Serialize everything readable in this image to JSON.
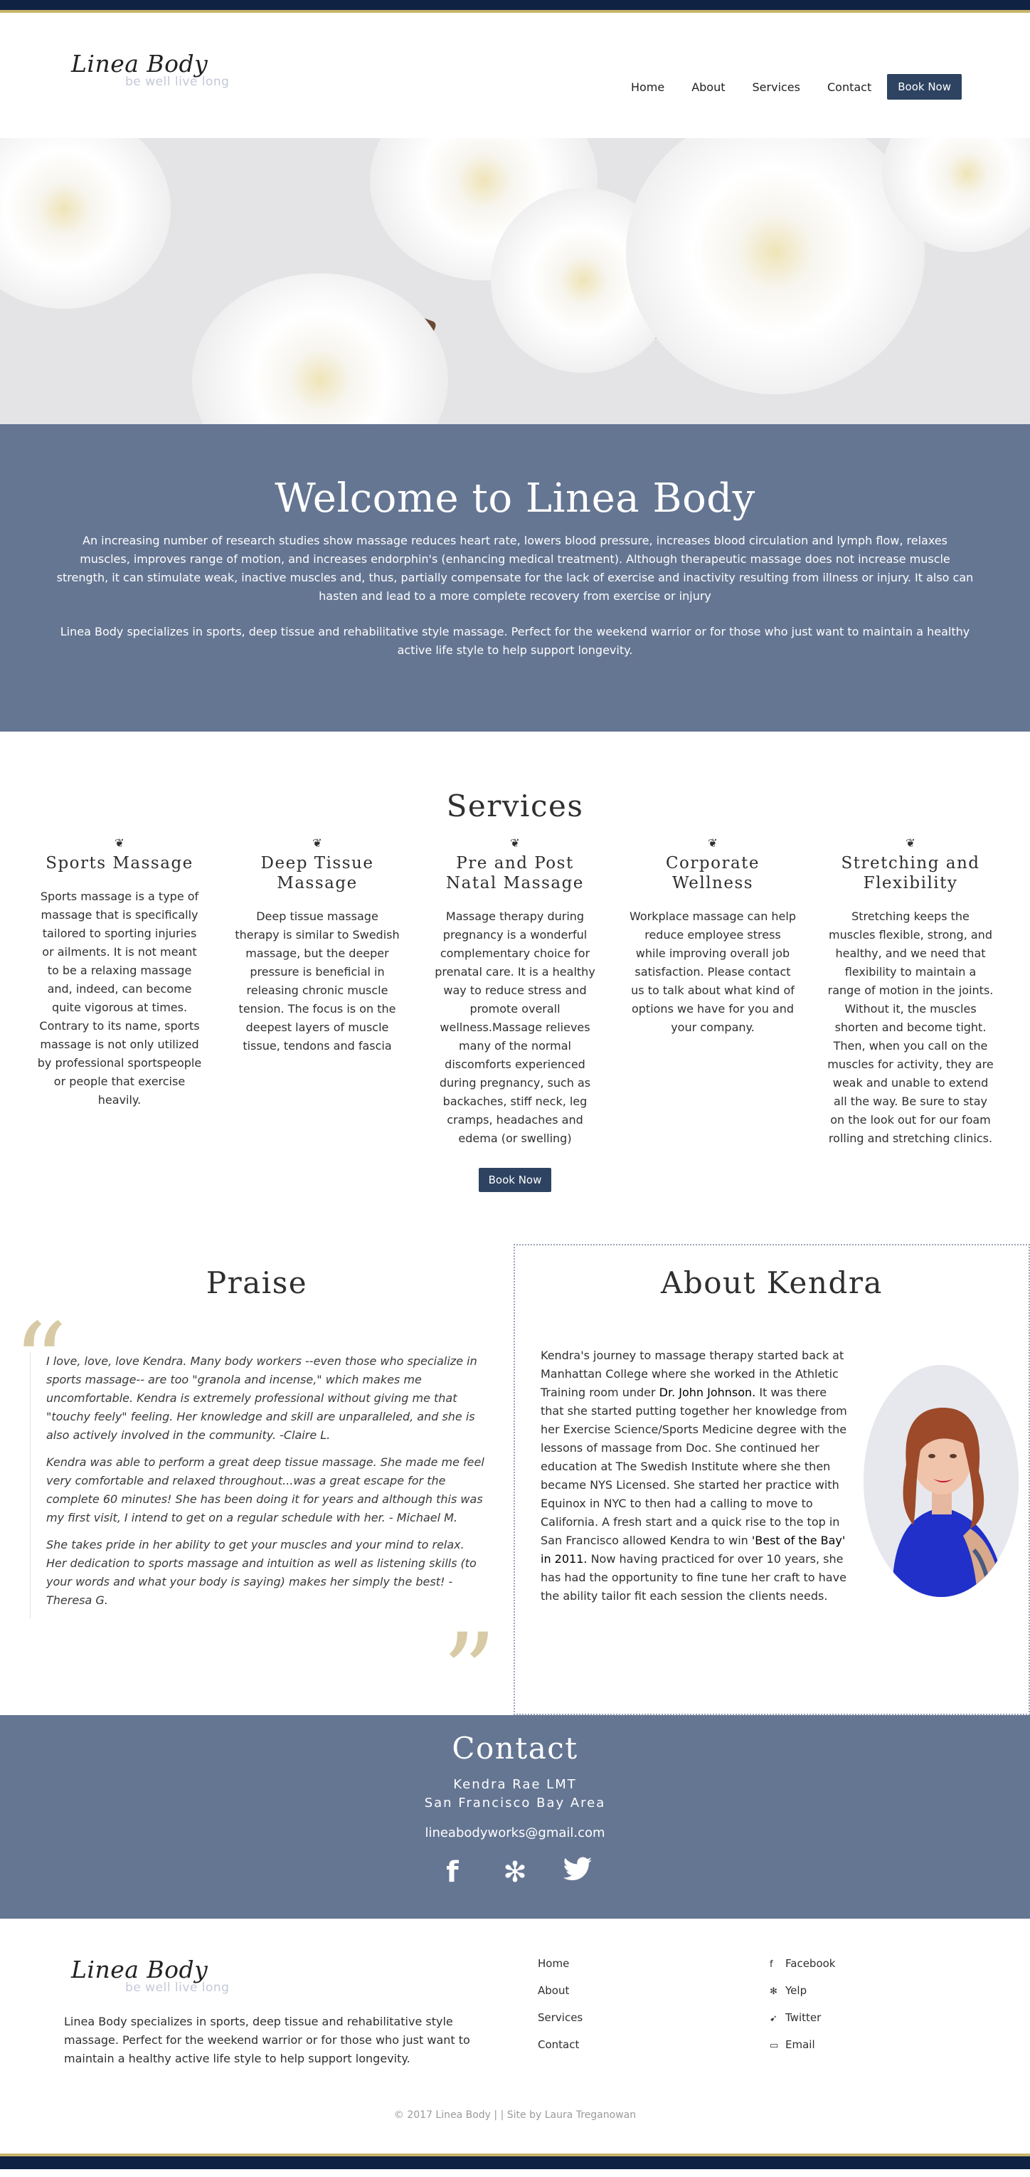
{
  "brand": {
    "name": "Linea Body",
    "tagline": "be well live long"
  },
  "nav": {
    "home": "Home",
    "about": "About",
    "services": "Services",
    "contact": "Contact",
    "book": "Book Now"
  },
  "welcome": {
    "title": "Welcome to Linea Body",
    "p1": "An increasing number of research studies show massage reduces heart rate, lowers blood pressure, increases blood circulation and lymph flow, relaxes muscles, improves range of motion, and increases endorphin's (enhancing medical treatment). Although therapeutic massage does not increase muscle strength, it can stimulate weak, inactive muscles and, thus, partially compensate for the lack of exercise and inactivity resulting from illness or injury. It also can hasten and lead to a more complete recovery from exercise or injury",
    "p2": "Linea Body specializes in sports, deep tissue and rehabilitative style massage. Perfect for the weekend warrior or for those who just want to maintain a healthy active life style to help support longevity."
  },
  "services": {
    "title": "Services",
    "items": [
      {
        "name": "Sports Massage",
        "desc": "Sports massage is a type of massage that is specifically tailored to sporting injuries or ailments. It is not meant to be a relaxing massage and, indeed, can become quite vigorous at times. Contrary to its name, sports massage is not only utilized by professional sportspeople or people that exercise heavily."
      },
      {
        "name": "Deep Tissue Massage",
        "desc": "Deep tissue massage therapy is similar to Swedish massage, but the deeper pressure is beneficial in releasing chronic muscle tension. The focus is on the deepest layers of muscle tissue, tendons and fascia"
      },
      {
        "name": "Pre and Post Natal Massage",
        "desc": "Massage therapy during pregnancy is a wonderful complementary choice for prenatal care. It is a healthy way to reduce stress and promote overall wellness.Massage relieves many of the normal discomforts experienced during pregnancy, such as backaches, stiff neck, leg cramps, headaches and edema (or swelling)"
      },
      {
        "name": "Corporate Wellness",
        "desc": "Workplace massage can help reduce employee stress while improving overall job satisfaction. Please contact us to talk about what kind of options we have for you and your company."
      },
      {
        "name": "Stretching and Flexibility",
        "desc": "Stretching keeps the muscles flexible, strong, and healthy, and we need that flexibility to maintain a range of motion in the joints. Without it, the muscles shorten and become tight. Then, when you call on the muscles for activity, they are weak and unable to extend all the way. Be sure to stay on the look out for our foam rolling and stretching clinics."
      }
    ],
    "book": "Book Now"
  },
  "praise": {
    "title": "Praise",
    "quotes": [
      "I love, love, love Kendra. Many body workers --even those who specialize in sports massage-- are too \"granola and incense,\" which makes me uncomfortable. Kendra is extremely professional without giving me that \"touchy feely\" feeling. Her knowledge and skill are unparalleled, and she is also actively involved in the community. -Claire L.",
      "Kendra was able to perform a great deep tissue massage. She made me feel very comfortable and relaxed throughout...was a great escape for the complete 60 minutes! She has been doing it for years and although this was my first visit, I intend to get on a regular schedule with her. - Michael M.",
      "She takes pride in her ability to get your muscles and your mind to relax. Her dedication to sports massage and intuition as well as listening skills (to your words and what your body is saying) makes her simply the best! - Theresa G."
    ]
  },
  "about": {
    "title": "About Kendra",
    "bio_a": "Kendra's journey to massage therapy started back at Manhattan College where she worked in the Athletic Training room under ",
    "bio_b": "Dr. John Johnson.",
    "bio_c": " It was there that she started putting together her knowledge from her Exercise Science/Sports Medicine degree with the lessons of massage from Doc. She continued her education at The Swedish Institute where she then became NYS Licensed. She started her practice with Equinox in NYC to then had a calling to move to California. A fresh start and a quick rise to the top in San Francisco allowed Kendra to win ",
    "bio_d": "'Best of the Bay' in 2011.",
    "bio_e": " Now having practiced for over 10 years, she has had the opportunity to fine tune her craft to have the ability tailor fit each session the clients needs."
  },
  "contact": {
    "title": "Contact",
    "name": "Kendra Rae LMT",
    "area": "San Francisco Bay Area",
    "email": "lineabodyworks@gmail.com",
    "icons": [
      "facebook-icon",
      "yelp-icon",
      "twitter-icon"
    ]
  },
  "footer": {
    "desc": "Linea Body specializes in sports, deep tissue and rehabilitative style massage. Perfect for the weekend warrior or for those who just want to maintain a healthy active life style to help support longevity.",
    "links": [
      "Home",
      "About",
      "Services",
      "Contact"
    ],
    "social": [
      "Facebook",
      "Yelp",
      "Twitter",
      "Email"
    ],
    "copyright": "© 2017 Linea Body | | Site by Laura Treganowan"
  },
  "colors": {
    "navy": "#0f2244",
    "gold": "#c8b46a",
    "slate": "#657693",
    "button": "#2d4361"
  }
}
